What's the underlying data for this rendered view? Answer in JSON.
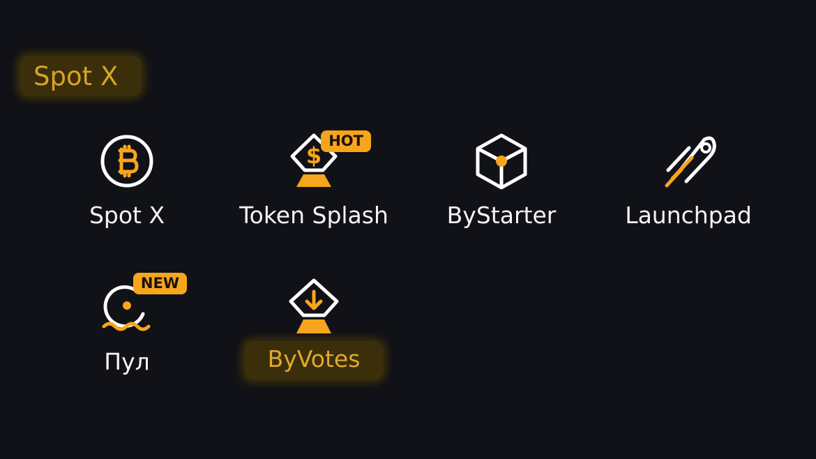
{
  "section": {
    "title": "Spot X"
  },
  "items": [
    {
      "label": "Spot X",
      "icon": "bitcoin-icon",
      "badge": ""
    },
    {
      "label": "Token Splash",
      "icon": "token-splash-icon",
      "badge": "HOT"
    },
    {
      "label": "ByStarter",
      "icon": "cube-icon",
      "badge": ""
    },
    {
      "label": "Launchpad",
      "icon": "rocket-icon",
      "badge": ""
    },
    {
      "label": "Пул",
      "icon": "pool-icon",
      "badge": "NEW"
    },
    {
      "label": "ByVotes",
      "icon": "vote-download-icon",
      "badge": ""
    }
  ],
  "colors": {
    "background": "#111217",
    "accent": "#f7a51c",
    "highlight_bg": "#3a2e0b",
    "highlight_text": "#d9a324",
    "text": "#f4f4f4"
  }
}
